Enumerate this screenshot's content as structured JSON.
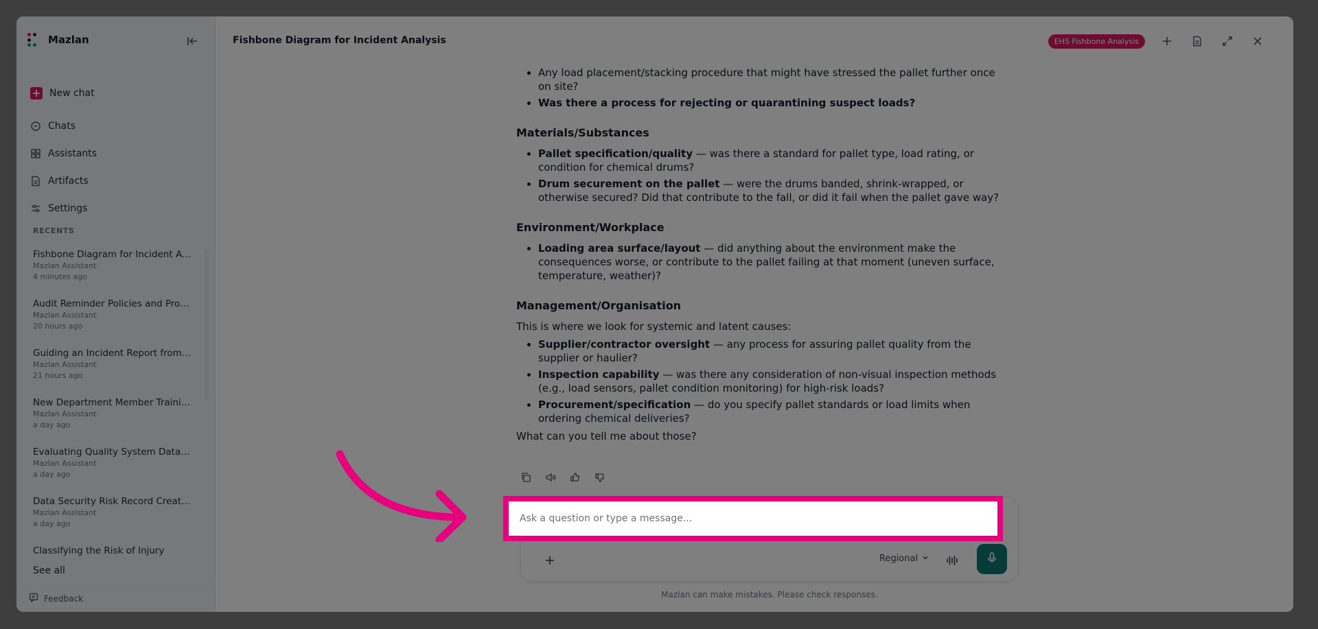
{
  "brand": {
    "name": "Mazlan",
    "logo_colors": [
      "#d81b60",
      "#16a34a",
      "#1f2937"
    ]
  },
  "sidebar": {
    "new_chat": "New chat",
    "nav": [
      {
        "label": "Chats",
        "icon": "chat-bubble-icon"
      },
      {
        "label": "Assistants",
        "icon": "grid-icon"
      },
      {
        "label": "Artifacts",
        "icon": "document-icon"
      },
      {
        "label": "Settings",
        "icon": "sliders-icon"
      }
    ],
    "recents_label": "RECENTS",
    "recents": [
      {
        "title": "Fishbone Diagram for Incident An...",
        "assistant": "Mazlan Assistant",
        "time": "4 minutes ago"
      },
      {
        "title": "Audit Reminder Policies and Proc...",
        "assistant": "Mazlan Assistant",
        "time": "20 hours ago"
      },
      {
        "title": "Guiding an Incident Report from I...",
        "assistant": "Mazlan Assistant",
        "time": "21 hours ago"
      },
      {
        "title": "New Department Member Trainin...",
        "assistant": "Mazlan Assistant",
        "time": "a day ago"
      },
      {
        "title": "Evaluating Quality System Data S...",
        "assistant": "Mazlan Assistant",
        "time": "a day ago"
      },
      {
        "title": "Data Security Risk Record Creati...",
        "assistant": "Mazlan Assistant",
        "time": "a day ago"
      },
      {
        "title": "Classifying the Risk of Injury",
        "assistant": "",
        "time": ""
      }
    ],
    "see_all": "See all",
    "feedback": "Feedback"
  },
  "header": {
    "title": "Fishbone Diagram for Incident Analysis",
    "badge": "EHS Fishbone Analysis"
  },
  "message": {
    "top_bullets": [
      {
        "text": "Any load placement/stacking procedure that might have stressed the pallet further once on site?",
        "bold": ""
      },
      {
        "text": "",
        "bold": "Was there a process for rejecting or quarantining suspect loads?"
      }
    ],
    "sections": [
      {
        "heading": "Materials/Substances",
        "intro": "",
        "bullets": [
          {
            "bold": "Pallet specification/quality",
            "text": " — was there a standard for pallet type, load rating, or condition for chemical drums?"
          },
          {
            "bold": "Drum securement on the pallet",
            "text": " — were the drums banded, shrink-wrapped, or otherwise secured? Did that contribute to the fall, or did it fail when the pallet gave way?"
          }
        ]
      },
      {
        "heading": "Environment/Workplace",
        "intro": "",
        "bullets": [
          {
            "bold": "Loading area surface/layout",
            "text": " — did anything about the environment make the consequences worse, or contribute to the pallet failing at that moment (uneven surface, temperature, weather)?"
          }
        ]
      },
      {
        "heading": "Management/Organisation",
        "intro": "This is where we look for systemic and latent causes:",
        "bullets": [
          {
            "bold": "Supplier/contractor oversight",
            "text": " — any process for assuring pallet quality from the supplier or haulier?"
          },
          {
            "bold": "Inspection capability",
            "text": " — was there any consideration of non-visual inspection methods (e.g., load sensors, pallet condition monitoring) for high-risk loads?"
          },
          {
            "bold": "Procurement/specification",
            "text": " — do you specify pallet standards or load limits when ordering chemical deliveries?"
          }
        ]
      }
    ],
    "closing": "What can you tell me about those?"
  },
  "composer": {
    "placeholder": "Ask a question or type a message...",
    "region": "Regional",
    "disclaimer": "Mazlan can make mistakes. Please check responses."
  },
  "colors": {
    "accent": "#d81b60",
    "highlight": "#e6007e",
    "mic": "#0f766e"
  }
}
